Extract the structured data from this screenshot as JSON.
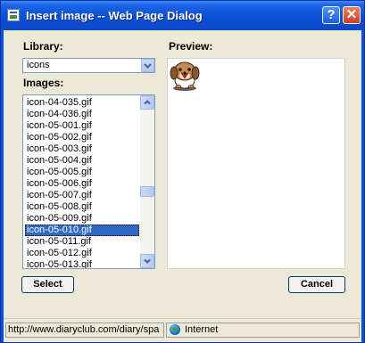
{
  "window": {
    "title": "Insert image -- Web Page Dialog"
  },
  "titlebar_buttons": {
    "help": "?",
    "close": "✕"
  },
  "library": {
    "label": "Library:",
    "selected": "icons"
  },
  "images": {
    "label": "Images:",
    "items": [
      "icon-04-035.gif",
      "icon-04-036.gif",
      "icon-05-001.gif",
      "icon-05-002.gif",
      "icon-05-003.gif",
      "icon-05-004.gif",
      "icon-05-005.gif",
      "icon-05-006.gif",
      "icon-05-007.gif",
      "icon-05-008.gif",
      "icon-05-009.gif",
      "icon-05-010.gif",
      "icon-05-011.gif",
      "icon-05-012.gif",
      "icon-05-013.gif"
    ],
    "selected": "icon-05-010.gif"
  },
  "preview": {
    "label": "Preview:",
    "image": "puppy-icon"
  },
  "buttons": {
    "select": "Select",
    "cancel": "Cancel"
  },
  "statusbar": {
    "url": "http://www.diaryclub.com/diary/spa",
    "zone": "Internet"
  },
  "colors": {
    "titlebar": "#0a4fd6",
    "selection": "#316ac5",
    "dialog_bg": "#ece9d8"
  }
}
